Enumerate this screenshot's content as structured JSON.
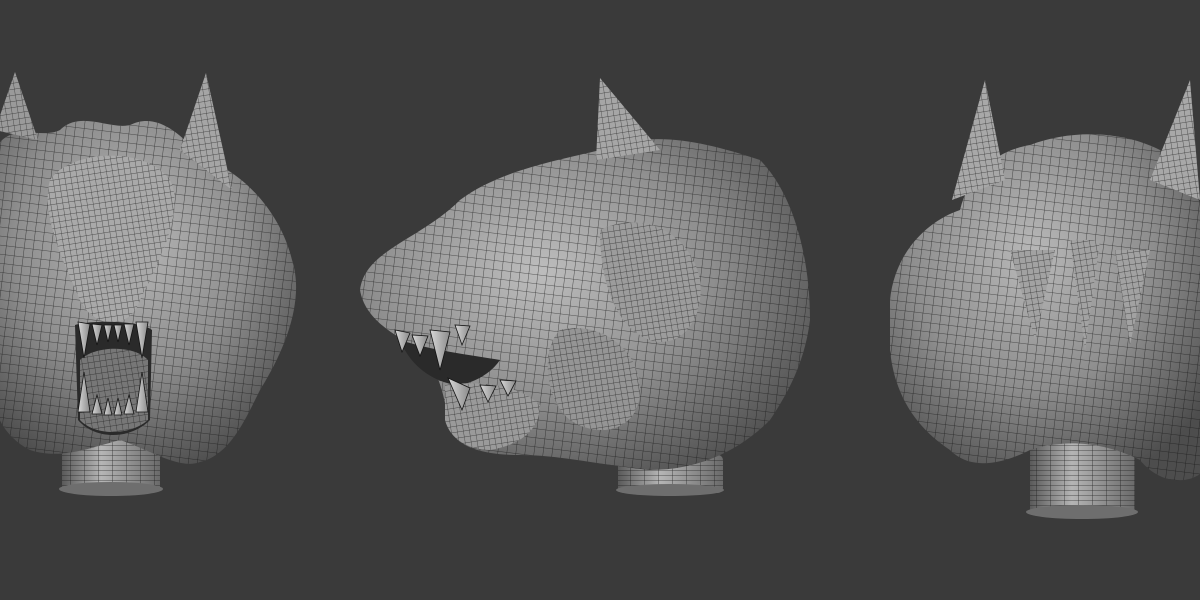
{
  "scene": {
    "background": "#3a3a3a",
    "mesh_fill": "#8e8e8e",
    "mesh_shadow": "#4d4d4d",
    "mesh_highlight": "#bdbdbd",
    "wire_color": "#141414",
    "views": [
      {
        "name": "front"
      },
      {
        "name": "side"
      },
      {
        "name": "back"
      }
    ]
  }
}
